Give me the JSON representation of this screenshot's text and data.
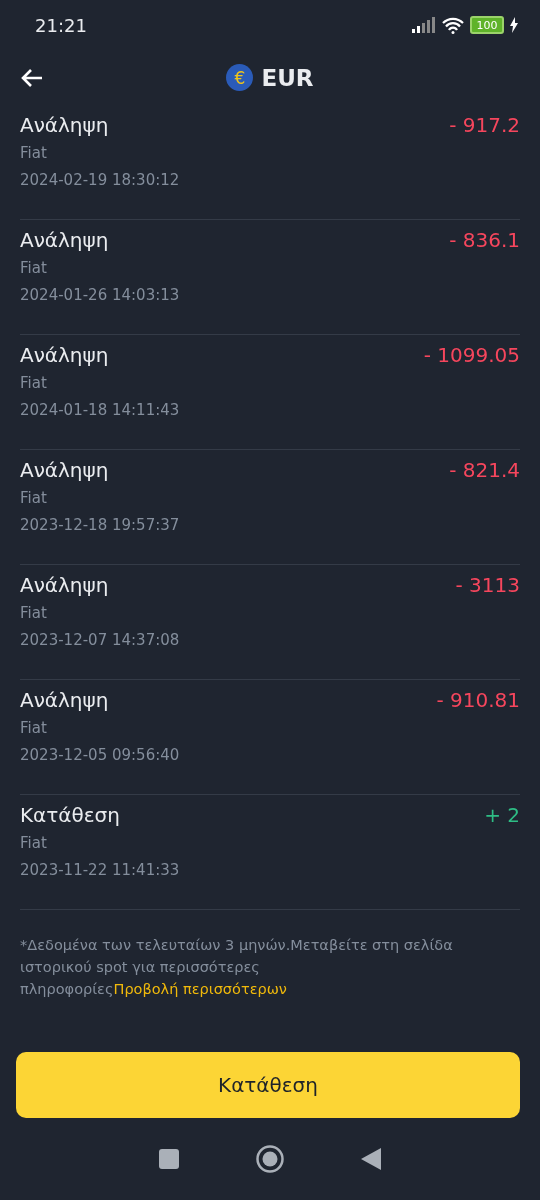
{
  "status_bar": {
    "time": "21:21",
    "battery": "100"
  },
  "header": {
    "title": "EUR",
    "icon_symbol": "€"
  },
  "transactions": [
    {
      "kind": "withdrawal",
      "title": "Ανάληψη",
      "amount": "- 917.2",
      "type": "Fiat",
      "date": "2024-02-19 18:30:12"
    },
    {
      "kind": "withdrawal",
      "title": "Ανάληψη",
      "amount": "- 836.1",
      "type": "Fiat",
      "date": "2024-01-26 14:03:13"
    },
    {
      "kind": "withdrawal",
      "title": "Ανάληψη",
      "amount": "- 1099.05",
      "type": "Fiat",
      "date": "2024-01-18 14:11:43"
    },
    {
      "kind": "withdrawal",
      "title": "Ανάληψη",
      "amount": "- 821.4",
      "type": "Fiat",
      "date": "2023-12-18 19:57:37"
    },
    {
      "kind": "withdrawal",
      "title": "Ανάληψη",
      "amount": "- 3113",
      "type": "Fiat",
      "date": "2023-12-07 14:37:08"
    },
    {
      "kind": "withdrawal",
      "title": "Ανάληψη",
      "amount": "- 910.81",
      "type": "Fiat",
      "date": "2023-12-05 09:56:40"
    },
    {
      "kind": "deposit",
      "title": "Κατάθεση",
      "amount": "+ 2",
      "type": "Fiat",
      "date": "2023-11-22 11:41:33"
    }
  ],
  "note": {
    "text": "*Δεδομένα των τελευταίων 3 μηνών.Μεταβείτε στη σελίδα ιστορικού spot για περισσότερες πληροφορίες",
    "link": "Προβολή περισσότερων"
  },
  "primary_button": "Κατάθεση"
}
